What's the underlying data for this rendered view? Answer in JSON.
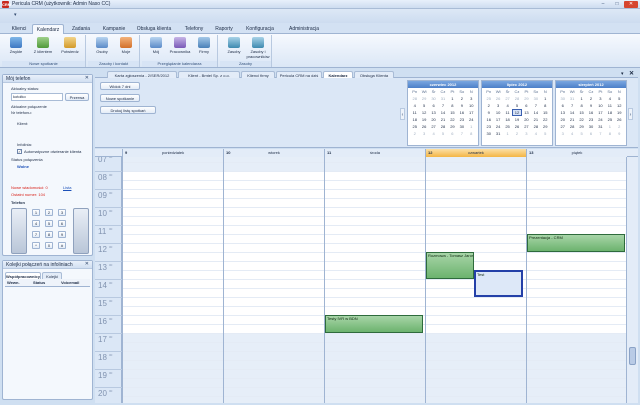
{
  "window": {
    "title": "Pericula CRM (użytkownik: Admin Naso CC)",
    "logo": "CRM",
    "min": "–",
    "max": "□",
    "close": "✕"
  },
  "qat": {
    "arrow": "▾"
  },
  "menu": {
    "tabs": [
      "Klienci",
      "Kalendarz",
      "Zadania",
      "Kampanie",
      "Obsługa klienta",
      "Telefony",
      "Raporty",
      "Konfiguracja",
      "Administracja"
    ],
    "active_index": 1
  },
  "ribbon": {
    "groups": [
      {
        "label": "Nowe spotkanie",
        "buttons": [
          "Zwykłe",
          "Z klientem",
          "Potwierdz"
        ]
      },
      {
        "label": "Zasoby i kontakt",
        "buttons": [
          "Osoby",
          "Moje"
        ]
      },
      {
        "label": "Przeglądanie kalendarza",
        "buttons": [
          "Mój",
          "Pracownika",
          "Firmy"
        ]
      },
      {
        "label": "Zasoby",
        "buttons": [
          "Zasoby",
          "Zasoby i pracowników"
        ]
      }
    ]
  },
  "phone_panel": {
    "title": "Mój telefon",
    "status_label": "Aktualny status:",
    "status_value": "kotołko",
    "status_button": "Przerwa",
    "current_call_label": "Aktualne połączenie",
    "current_call_value": "Nr telefonu:",
    "client_label": "Klient:",
    "info_label": "Infolinia:",
    "auto_label": "Automatyczne otwieranie klienta",
    "conn_status_label": "Status połączenia",
    "conn_status_value": "Wolne",
    "new_messages": "Nowe wiadomości: 0",
    "new_messages_link": "Lista",
    "last_number": "Ostatni numer: 104",
    "phone_label": "Telefon",
    "keys": [
      "1",
      "2",
      "3",
      "4",
      "5",
      "6",
      "7",
      "8",
      "9",
      "*",
      "0",
      "#"
    ]
  },
  "queue_panel": {
    "title": "Kolejki połączeń na infoliniach",
    "tabs": [
      "Współpracownicy",
      "Kolejki"
    ],
    "columns": [
      "Wewn.",
      "Status",
      "Voicemail"
    ]
  },
  "doc_tabs": [
    "Karta zgłoszenia - 2/SER/2012",
    "Klient - Bmtel Sp. z o.o.",
    "Klienci firmy",
    "Pericula CRM na dziś",
    "Kalendarz",
    "Obsługa Klienta"
  ],
  "doc_active_index": 4,
  "toolbar": {
    "view_label": "Widok 7 dni",
    "new_meeting": "Nowe spotkanie",
    "print": "Drukuj listę spotkań"
  },
  "months": [
    {
      "name": "czerwiec 2012",
      "days": [
        "Pn",
        "Wt",
        "Śr",
        "Cz",
        "Pt",
        "So",
        "N"
      ],
      "weeks": [
        [
          "28",
          "29",
          "30",
          "31",
          "1",
          "2",
          "3"
        ],
        [
          "4",
          "5",
          "6",
          "7",
          "8",
          "9",
          "10"
        ],
        [
          "11",
          "12",
          "13",
          "14",
          "15",
          "16",
          "17"
        ],
        [
          "18",
          "19",
          "20",
          "21",
          "22",
          "23",
          "24"
        ],
        [
          "25",
          "26",
          "27",
          "28",
          "29",
          "30",
          "1"
        ],
        [
          "2",
          "3",
          "4",
          "5",
          "6",
          "7",
          "8"
        ]
      ]
    },
    {
      "name": "lipiec 2012",
      "days": [
        "Pn",
        "Wt",
        "Śr",
        "Cz",
        "Pt",
        "So",
        "N"
      ],
      "weeks": [
        [
          "25",
          "26",
          "27",
          "28",
          "29",
          "30",
          "1"
        ],
        [
          "2",
          "3",
          "4",
          "5",
          "6",
          "7",
          "8"
        ],
        [
          "9",
          "10",
          "11",
          "12",
          "13",
          "14",
          "15"
        ],
        [
          "16",
          "17",
          "18",
          "19",
          "20",
          "21",
          "22"
        ],
        [
          "23",
          "24",
          "25",
          "26",
          "27",
          "28",
          "29"
        ],
        [
          "30",
          "31",
          "1",
          "2",
          "3",
          "4",
          "5"
        ]
      ],
      "today": "12"
    },
    {
      "name": "sierpień 2012",
      "days": [
        "Pn",
        "Wt",
        "Śr",
        "Cz",
        "Pt",
        "So",
        "N"
      ],
      "weeks": [
        [
          "30",
          "31",
          "1",
          "2",
          "3",
          "4",
          "5"
        ],
        [
          "6",
          "7",
          "8",
          "9",
          "10",
          "11",
          "12"
        ],
        [
          "13",
          "14",
          "15",
          "16",
          "17",
          "18",
          "19"
        ],
        [
          "20",
          "21",
          "22",
          "23",
          "24",
          "25",
          "26"
        ],
        [
          "27",
          "28",
          "29",
          "30",
          "31",
          "1",
          "2"
        ],
        [
          "3",
          "4",
          "5",
          "6",
          "7",
          "8",
          "9"
        ]
      ]
    }
  ],
  "week": {
    "days": [
      {
        "num": "9",
        "name": "poniedziałek"
      },
      {
        "num": "10",
        "name": "wtorek"
      },
      {
        "num": "11",
        "name": "środa"
      },
      {
        "num": "12",
        "name": "czwartek",
        "today": true
      },
      {
        "num": "13",
        "name": "piątek"
      }
    ],
    "hours": [
      "07",
      "08",
      "09",
      "10",
      "11",
      "12",
      "13",
      "14",
      "15",
      "16",
      "17",
      "18",
      "19",
      "20"
    ],
    "minutes": "00"
  },
  "appointments": [
    {
      "day": 2,
      "start": 16.0,
      "end": 17.0,
      "title": "Testy IVR w BDN"
    },
    {
      "day": 3,
      "start": 12.5,
      "end": 14.0,
      "title": "Rozmowa - Tomasz Jarosz"
    },
    {
      "day": 3,
      "start": 13.5,
      "end": 15.0,
      "title": "Test",
      "selected": true
    },
    {
      "day": 4,
      "start": 11.5,
      "end": 12.5,
      "title": "Prezentacja - CRM"
    }
  ]
}
